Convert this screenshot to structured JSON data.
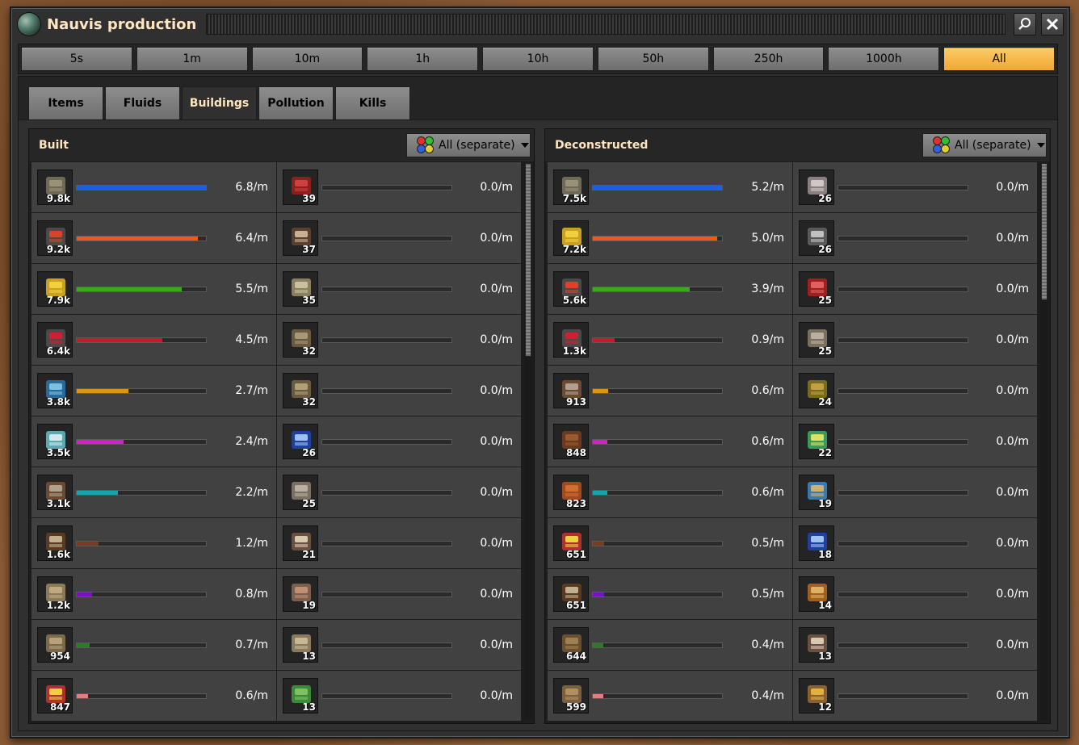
{
  "window": {
    "title": "Nauvis production"
  },
  "time_ranges": [
    {
      "label": "5s",
      "active": false
    },
    {
      "label": "1m",
      "active": false
    },
    {
      "label": "10m",
      "active": false
    },
    {
      "label": "1h",
      "active": false
    },
    {
      "label": "10h",
      "active": false
    },
    {
      "label": "50h",
      "active": false
    },
    {
      "label": "250h",
      "active": false
    },
    {
      "label": "1000h",
      "active": false
    },
    {
      "label": "All",
      "active": true
    }
  ],
  "tabs": [
    {
      "label": "Items",
      "active": false
    },
    {
      "label": "Fluids",
      "active": false
    },
    {
      "label": "Buildings",
      "active": true
    },
    {
      "label": "Pollution",
      "active": false
    },
    {
      "label": "Kills",
      "active": false
    }
  ],
  "panels": {
    "built": {
      "title": "Built",
      "filter_label": "All (separate)",
      "rows": [
        {
          "count": "9.8k",
          "rate": "6.8/m",
          "bar": 1.0,
          "color": "#1c5fe0",
          "icon": "stone-wall-icon"
        },
        {
          "count": "9.2k",
          "rate": "6.4/m",
          "bar": 0.94,
          "color": "#ee5a14",
          "icon": "fast-transport-belt-icon"
        },
        {
          "count": "7.9k",
          "rate": "5.5/m",
          "bar": 0.81,
          "color": "#3ca81e",
          "icon": "fast-inserter-icon"
        },
        {
          "count": "6.4k",
          "rate": "4.5/m",
          "bar": 0.66,
          "color": "#c41a2a",
          "icon": "express-transport-belt-icon"
        },
        {
          "count": "3.8k",
          "rate": "2.7/m",
          "bar": 0.4,
          "color": "#d49a10",
          "icon": "solar-panel-icon"
        },
        {
          "count": "3.5k",
          "rate": "2.4/m",
          "bar": 0.36,
          "color": "#d81cd0",
          "icon": "assembling-machine-icon"
        },
        {
          "count": "3.1k",
          "rate": "2.2/m",
          "bar": 0.32,
          "color": "#12a6b0",
          "icon": "medium-electric-pole-icon"
        },
        {
          "count": "1.6k",
          "rate": "1.2/m",
          "bar": 0.17,
          "color": "#7a3a20",
          "icon": "small-electric-pole-icon"
        },
        {
          "count": "1.2k",
          "rate": "0.8/m",
          "bar": 0.12,
          "color": "#7a10c0",
          "icon": "pipe-icon"
        },
        {
          "count": "954",
          "rate": "0.7/m",
          "bar": 0.1,
          "color": "#2e7a28",
          "icon": "pipe-to-ground-icon"
        },
        {
          "count": "847",
          "rate": "0.6/m",
          "bar": 0.09,
          "color": "#e08080",
          "icon": "long-handed-inserter-icon"
        },
        {
          "count": "39",
          "rate": "0.0/m",
          "bar": 0,
          "color": "#888888",
          "icon": "splitter-icon"
        },
        {
          "count": "37",
          "rate": "0.0/m",
          "bar": 0,
          "color": "#888888",
          "icon": "assembling-machine-box-icon"
        },
        {
          "count": "35",
          "rate": "0.0/m",
          "bar": 0,
          "color": "#888888",
          "icon": "radar-icon"
        },
        {
          "count": "32",
          "rate": "0.0/m",
          "bar": 0,
          "color": "#888888",
          "icon": "rail-icon"
        },
        {
          "count": "32",
          "rate": "0.0/m",
          "bar": 0,
          "color": "#888888",
          "icon": "curved-rail-icon"
        },
        {
          "count": "26",
          "rate": "0.0/m",
          "bar": 0,
          "color": "#888888",
          "icon": "rocket-part-icon"
        },
        {
          "count": "25",
          "rate": "0.0/m",
          "bar": 0,
          "color": "#888888",
          "icon": "rock-icon"
        },
        {
          "count": "21",
          "rate": "0.0/m",
          "bar": 0,
          "color": "#888888",
          "icon": "electric-furnace-icon"
        },
        {
          "count": "19",
          "rate": "0.0/m",
          "bar": 0,
          "color": "#888888",
          "icon": "pump-icon"
        },
        {
          "count": "13",
          "rate": "0.0/m",
          "bar": 0,
          "color": "#888888",
          "icon": "storage-tank-icon"
        },
        {
          "count": "13",
          "rate": "0.0/m",
          "bar": 0,
          "color": "#888888",
          "icon": "pumpjack-icon"
        }
      ]
    },
    "deconstructed": {
      "title": "Deconstructed",
      "filter_label": "All (separate)",
      "rows": [
        {
          "count": "7.5k",
          "rate": "5.2/m",
          "bar": 1.0,
          "color": "#1c5fe0",
          "icon": "stone-wall-icon"
        },
        {
          "count": "7.2k",
          "rate": "5.0/m",
          "bar": 0.96,
          "color": "#ee5a14",
          "icon": "fast-inserter-icon"
        },
        {
          "count": "5.6k",
          "rate": "3.9/m",
          "bar": 0.75,
          "color": "#3ca81e",
          "icon": "fast-transport-belt-icon"
        },
        {
          "count": "1.3k",
          "rate": "0.9/m",
          "bar": 0.17,
          "color": "#c41a2a",
          "icon": "express-transport-belt-icon"
        },
        {
          "count": "913",
          "rate": "0.6/m",
          "bar": 0.12,
          "color": "#d49a10",
          "icon": "medium-electric-pole-icon"
        },
        {
          "count": "848",
          "rate": "0.6/m",
          "bar": 0.11,
          "color": "#d81cd0",
          "icon": "dead-tree-icon"
        },
        {
          "count": "823",
          "rate": "0.6/m",
          "bar": 0.11,
          "color": "#12a6b0",
          "icon": "autumn-tree-icon"
        },
        {
          "count": "651",
          "rate": "0.5/m",
          "bar": 0.09,
          "color": "#7a3a20",
          "icon": "long-handed-inserter-icon"
        },
        {
          "count": "651",
          "rate": "0.5/m",
          "bar": 0.09,
          "color": "#7a10c0",
          "icon": "small-electric-pole-icon"
        },
        {
          "count": "644",
          "rate": "0.4/m",
          "bar": 0.08,
          "color": "#2e7a28",
          "icon": "dry-tree-icon"
        },
        {
          "count": "599",
          "rate": "0.4/m",
          "bar": 0.08,
          "color": "#e08080",
          "icon": "bare-tree-icon"
        },
        {
          "count": "26",
          "rate": "0.0/m",
          "bar": 0,
          "color": "#888888",
          "icon": "gate-icon"
        },
        {
          "count": "26",
          "rate": "0.0/m",
          "bar": 0,
          "color": "#888888",
          "icon": "roboport-icon"
        },
        {
          "count": "25",
          "rate": "0.0/m",
          "bar": 0,
          "color": "#888888",
          "icon": "flag-icon"
        },
        {
          "count": "25",
          "rate": "0.0/m",
          "bar": 0,
          "color": "#888888",
          "icon": "rock-icon"
        },
        {
          "count": "24",
          "rate": "0.0/m",
          "bar": 0,
          "color": "#888888",
          "icon": "bush-icon"
        },
        {
          "count": "22",
          "rate": "0.0/m",
          "bar": 0,
          "color": "#888888",
          "icon": "fish-icon"
        },
        {
          "count": "19",
          "rate": "0.0/m",
          "bar": 0,
          "color": "#888888",
          "icon": "offshore-pump-icon"
        },
        {
          "count": "18",
          "rate": "0.0/m",
          "bar": 0,
          "color": "#888888",
          "icon": "rocket-part-icon"
        },
        {
          "count": "14",
          "rate": "0.0/m",
          "bar": 0,
          "color": "#888888",
          "icon": "character-icon"
        },
        {
          "count": "13",
          "rate": "0.0/m",
          "bar": 0,
          "color": "#888888",
          "icon": "electric-furnace-icon"
        },
        {
          "count": "12",
          "rate": "0.0/m",
          "bar": 0,
          "color": "#888888",
          "icon": "locomotive-icon"
        }
      ]
    }
  }
}
